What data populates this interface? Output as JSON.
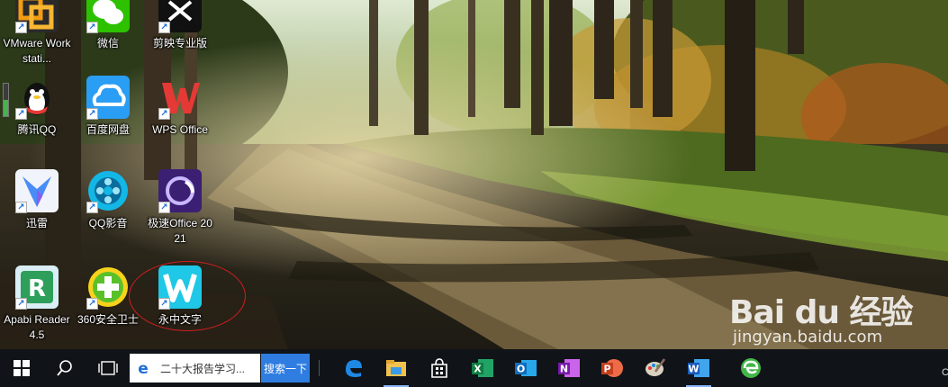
{
  "desktop": {
    "icons": [
      {
        "label": "VMware Workstati...",
        "icon": "vmware-icon",
        "color": "#f39c12"
      },
      {
        "label": "微信",
        "icon": "wechat-icon",
        "color": "#2dc100"
      },
      {
        "label": "剪映专业版",
        "icon": "jianying-icon",
        "color": "#111111"
      },
      {
        "label": "腾讯QQ",
        "icon": "qq-icon",
        "color": "#1aa0e8"
      },
      {
        "label": "百度网盘",
        "icon": "baidu-netdisk-icon",
        "color": "#2a9df4"
      },
      {
        "label": "WPS Office",
        "icon": "wps-icon",
        "color": "#e53935"
      },
      {
        "label": "迅雷",
        "icon": "xunlei-icon",
        "color": "#4a8cf7"
      },
      {
        "label": "QQ影音",
        "icon": "qq-player-icon",
        "color": "#13b7e6"
      },
      {
        "label": "极速Office 2021",
        "icon": "jisu-office-icon",
        "color": "#4b2a8c"
      },
      {
        "label": "Apabi Reader 4.5",
        "icon": "apabi-icon",
        "color": "#2e9e5b"
      },
      {
        "label": "360安全卫士",
        "icon": "360-icon",
        "color": "#5ac02a"
      },
      {
        "label": "永中文字",
        "icon": "yozo-writer-icon",
        "color": "#1ec8e6"
      }
    ]
  },
  "watermark": {
    "brand": "Bai du 经验",
    "url": "jingyan.baidu.com"
  },
  "taskbar": {
    "search_text": "二十大报告学习...",
    "search_button": "搜索一下",
    "apps": [
      {
        "name": "edge-icon"
      },
      {
        "name": "file-explorer-icon"
      },
      {
        "name": "store-icon"
      },
      {
        "name": "excel-icon"
      },
      {
        "name": "outlook-icon"
      },
      {
        "name": "onenote-icon"
      },
      {
        "name": "powerpoint-icon"
      },
      {
        "name": "paint-icon"
      },
      {
        "name": "word-icon"
      },
      {
        "name": "360-browser-icon"
      }
    ],
    "corner": "C"
  }
}
